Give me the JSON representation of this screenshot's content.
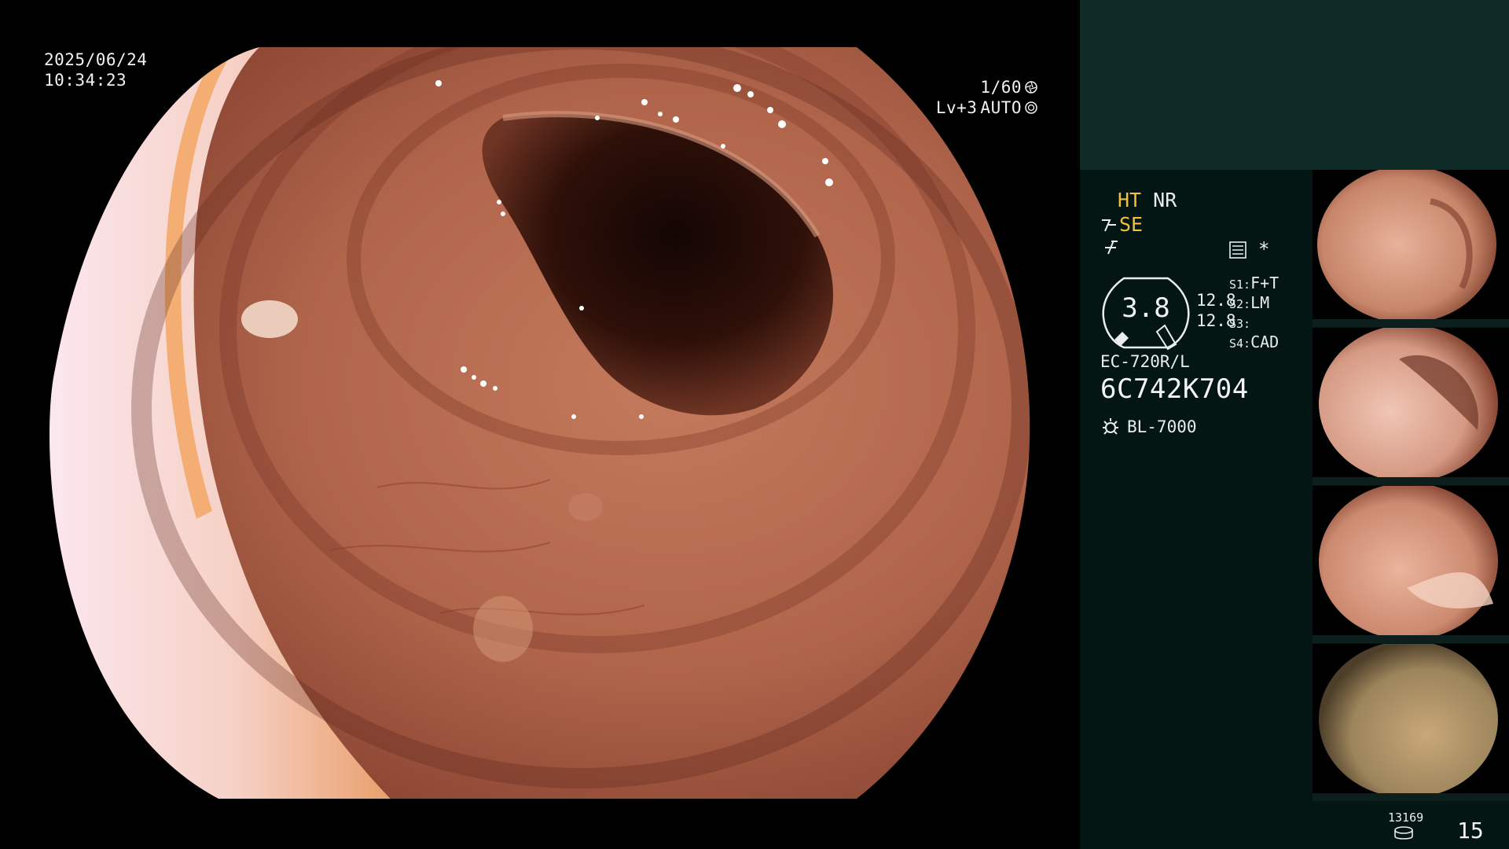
{
  "overlay": {
    "date": "2025/06/24",
    "time": "10:34:23",
    "shutter_speed": "1/60",
    "brightness_level": "Lv+3",
    "iris_mode": "AUTO"
  },
  "modes": {
    "ht": "HT",
    "nr": "NR",
    "se": "SE"
  },
  "zoom": {
    "value": "3.8",
    "enhancement_a": "12.8",
    "enhancement_b": "12.8"
  },
  "switches": [
    {
      "key": "S1:",
      "value": "F+T"
    },
    {
      "key": "S2:",
      "value": "LM"
    },
    {
      "key": "S3:",
      "value": ""
    },
    {
      "key": "S4:",
      "value": "CAD"
    }
  ],
  "scope": {
    "model": "EC-720R/L",
    "serial": "6C742K704",
    "light_source": "BL-7000"
  },
  "footer": {
    "image_count": "13169",
    "page_number": "15"
  },
  "icons": {
    "shutter": "shutter-icon",
    "iris": "iris-icon",
    "se_mode": "structure-enhance-icon",
    "f_mode": "frequency-icon",
    "settings": "settings-list-icon",
    "star": "asterisk-icon",
    "light": "sun-icon",
    "storage": "database-icon"
  },
  "colors": {
    "panel_bg": "#041613",
    "panel_top": "#0e2b27",
    "mode_active": "#f2c040"
  }
}
